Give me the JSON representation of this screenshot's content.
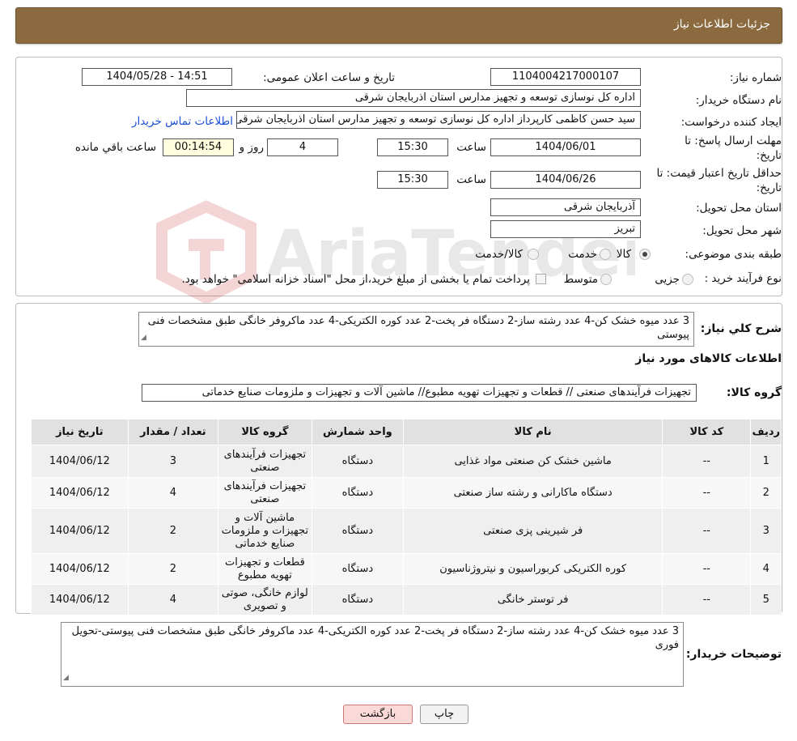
{
  "header": {
    "title": "جزئیات اطلاعات نیاز"
  },
  "form": {
    "need_number_label": "شماره نیاز:",
    "need_number": "1104004217000107",
    "announce_label": "تاریخ و ساعت اعلان عمومی:",
    "announce_value": "1404/05/28 - 14:51",
    "buyer_label": "نام دستگاه خریدار:",
    "buyer_value": "اداره کل نوسازی  توسعه و تجهیز مدارس استان اذربایجان شرقی",
    "creator_label": "ایجاد کننده درخواست:",
    "creator_value": "سید حسن کاظمی کارپرداز اداره کل نوسازی  توسعه و تجهیز مدارس استان اذربایجان شرقی",
    "contact_link": "اطلاعات تماس خریدار",
    "reply_label_1": "مهلت ارسال پاسخ: تا",
    "reply_label_2": "تاریخ:",
    "reply_date": "1404/06/01",
    "time_label": "ساعت",
    "reply_time": "15:30",
    "days_value": "4",
    "days_label": "روز و",
    "remaining_time": "00:14:54",
    "remaining_label": "ساعت باقي مانده",
    "validity_label_1": "حداقل تاریخ اعتبار قیمت: تا",
    "validity_label_2": "تاریخ:",
    "validity_date": "1404/06/26",
    "validity_time": "15:30",
    "province_label": "استان محل تحویل:",
    "province_value": "آذربایجان شرقی",
    "city_label": "شهر محل تحویل:",
    "city_value": "تبریز",
    "category_label": "طبقه بندی موضوعی:",
    "category_options": [
      "کالا",
      "خدمت",
      "کالا/خدمت"
    ],
    "process_label": "نوع فرآیند خرید :",
    "process_options": [
      "جزیی",
      "متوسط"
    ],
    "process_note": "پرداخت تمام یا بخشی از مبلغ خرید،از محل \"اسناد خزانه اسلامی\" خواهد بود."
  },
  "description": {
    "label": "شرح کلي نياز:",
    "text": "3 عدد میوه خشک کن-4 عدد رشته ساز-2 دستگاه فر پخت-2 عدد کوره الکتریکی-4 عدد ماکروفر خانگی طبق مشخصات فنی پیوستی"
  },
  "goods": {
    "section_title": "اطلاعات کالاهای مورد نیاز",
    "group_label": "گروه کالا:",
    "group_value": "تجهیزات فرآیندهای صنعتی //  قطعات و تجهیزات تهویه مطبوع// ماشین آلات و تجهیزات و ملزومات صنایع خدماتی",
    "columns": [
      "ردیف",
      "کد کالا",
      "نام کالا",
      "واحد شمارش",
      "گروه کالا",
      "تعداد / مقدار",
      "تاریخ نیاز"
    ],
    "rows": [
      {
        "row": "1",
        "code": "--",
        "name": "ماشین خشک کن صنعتی مواد غذایی",
        "unit": "دستگاه",
        "group": "تجهیزات فرآیندهای صنعتی",
        "qty": "3",
        "date": "1404/06/12"
      },
      {
        "row": "2",
        "code": "--",
        "name": "دستگاه ماکارانی و رشته ساز صنعتی",
        "unit": "دستگاه",
        "group": "تجهیزات فرآیندهای صنعتی",
        "qty": "4",
        "date": "1404/06/12"
      },
      {
        "row": "3",
        "code": "--",
        "name": "فر شیرینی پزی صنعتی",
        "unit": "دستگاه",
        "group": "ماشین آلات و تجهیزات و ملزومات صنایع خدماتی",
        "qty": "2",
        "date": "1404/06/12"
      },
      {
        "row": "4",
        "code": "--",
        "name": "کوره الکتریکی کربوراسیون و نیتروژناسیون",
        "unit": "دستگاه",
        "group": "قطعات و تجهیزات تهویه مطبوع",
        "qty": "2",
        "date": "1404/06/12"
      },
      {
        "row": "5",
        "code": "--",
        "name": "فر توستر خانگی",
        "unit": "دستگاه",
        "group": "لوازم خانگی، صوتی و تصویری",
        "qty": "4",
        "date": "1404/06/12"
      }
    ]
  },
  "buyer_notes": {
    "label": "توضیحات خریدار:",
    "text": "3 عدد میوه خشک کن-4 عدد رشته ساز-2 دستگاه فر پخت-2 عدد کوره الکتریکی-4 عدد ماکروفر خانگی طبق مشخصات فنی پیوستی-تحویل فوری"
  },
  "buttons": {
    "print": "چاپ",
    "back": "بازگشت"
  },
  "watermark": {
    "text": "AriaTender.neT"
  },
  "colors": {
    "header_bg": "#8b6a3f",
    "link": "#1a4fd6",
    "remaining_bg": "#ffffe0",
    "back_bg": "#fbd9d9"
  }
}
